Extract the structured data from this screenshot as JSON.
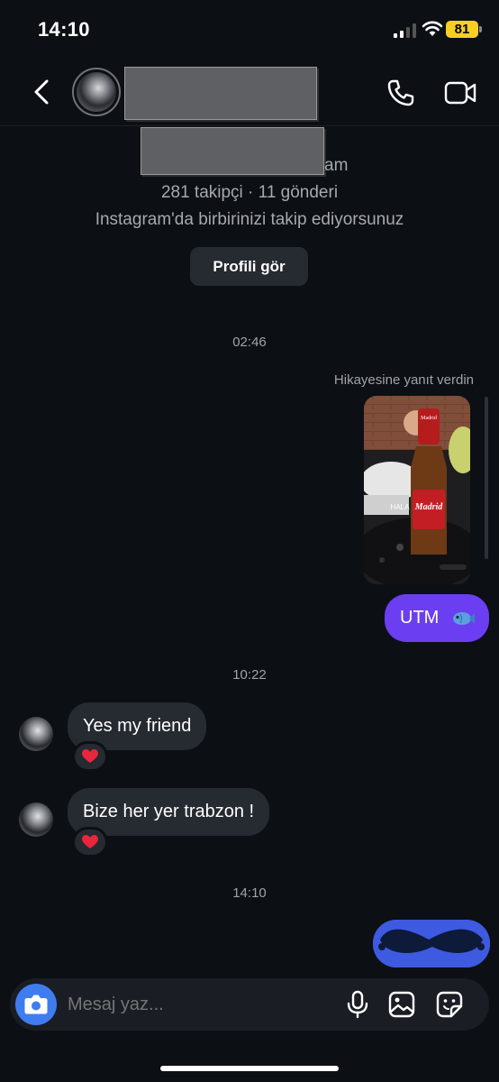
{
  "status": {
    "time": "14:10",
    "battery": "81"
  },
  "header": {},
  "profile": {
    "username_tail": "am",
    "stats": "281 takipçi · 11 gönderi",
    "follow_note": "Instagram'da birbirinizi takip ediyorsunuz",
    "view_profile_label": "Profili gör"
  },
  "thread": {
    "time_1": "02:46",
    "story_reply_label": "Hikayesine yanıt verdin",
    "story_text": "HALA",
    "story_brand": "Madrid",
    "out_message_1": "UTM",
    "time_2": "10:22",
    "in_message_1": "Yes my friend",
    "in_message_2": "Bize her yer trabzon !",
    "time_3": "14:10"
  },
  "composer": {
    "placeholder": "Mesaj yaz..."
  },
  "colors": {
    "outgoing_bubble": "#6b3ef2",
    "incoming_bubble": "#262a31",
    "camera_button": "#3f7cf0",
    "battery": "#f7cf22"
  },
  "icons": [
    "back-icon",
    "phone-icon",
    "video-camera-icon",
    "heart-icon",
    "fish-icon",
    "camera-icon",
    "microphone-icon",
    "gallery-icon",
    "sticker-icon"
  ]
}
